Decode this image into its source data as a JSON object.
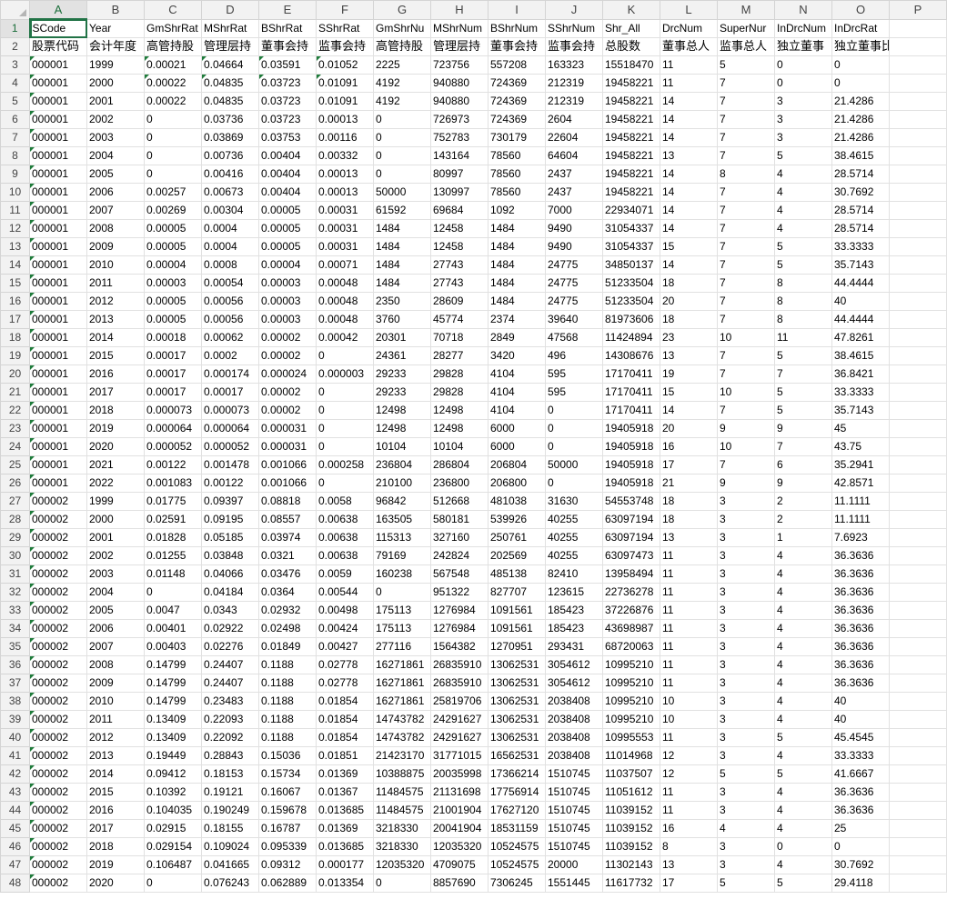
{
  "columns": [
    "A",
    "B",
    "C",
    "D",
    "E",
    "F",
    "G",
    "H",
    "I",
    "J",
    "K",
    "L",
    "M",
    "N",
    "O",
    "P"
  ],
  "selected_column": "A",
  "selected_row": 1,
  "rows": [
    [
      "SCode",
      "Year",
      "GmShrRat",
      "MShrRat",
      "BShrRat",
      "SShrRat",
      "GmShrNu",
      "MShrNum",
      "BShrNum",
      "SShrNum",
      "Shr_All",
      "DrcNum",
      "SuperNur",
      "InDrcNum",
      "InDrcRat",
      ""
    ],
    [
      "股票代码",
      "会计年度",
      "高管持股",
      "管理层持",
      "董事会持",
      "监事会持",
      "高管持股",
      "管理层持",
      "董事会持",
      "监事会持",
      "总股数",
      "董事总人",
      "监事总人",
      "独立董事",
      "独立董事比例（%）",
      ""
    ],
    [
      "000001",
      "1999",
      "0.00021",
      "0.04664",
      "0.03591",
      "0.01052",
      "2225",
      "723756",
      "557208",
      "163323",
      "15518470",
      "11",
      "5",
      "0",
      "0",
      ""
    ],
    [
      "000001",
      "2000",
      "0.00022",
      "0.04835",
      "0.03723",
      "0.01091",
      "4192",
      "940880",
      "724369",
      "212319",
      "19458221",
      "11",
      "7",
      "0",
      "0",
      ""
    ],
    [
      "000001",
      "2001",
      "0.00022",
      "0.04835",
      "0.03723",
      "0.01091",
      "4192",
      "940880",
      "724369",
      "212319",
      "19458221",
      "14",
      "7",
      "3",
      "21.4286",
      ""
    ],
    [
      "000001",
      "2002",
      "0",
      "0.03736",
      "0.03723",
      "0.00013",
      "0",
      "726973",
      "724369",
      "2604",
      "19458221",
      "14",
      "7",
      "3",
      "21.4286",
      ""
    ],
    [
      "000001",
      "2003",
      "0",
      "0.03869",
      "0.03753",
      "0.00116",
      "0",
      "752783",
      "730179",
      "22604",
      "19458221",
      "14",
      "7",
      "3",
      "21.4286",
      ""
    ],
    [
      "000001",
      "2004",
      "0",
      "0.00736",
      "0.00404",
      "0.00332",
      "0",
      "143164",
      "78560",
      "64604",
      "19458221",
      "13",
      "7",
      "5",
      "38.4615",
      ""
    ],
    [
      "000001",
      "2005",
      "0",
      "0.00416",
      "0.00404",
      "0.00013",
      "0",
      "80997",
      "78560",
      "2437",
      "19458221",
      "14",
      "8",
      "4",
      "28.5714",
      ""
    ],
    [
      "000001",
      "2006",
      "0.00257",
      "0.00673",
      "0.00404",
      "0.00013",
      "50000",
      "130997",
      "78560",
      "2437",
      "19458221",
      "14",
      "7",
      "4",
      "30.7692",
      ""
    ],
    [
      "000001",
      "2007",
      "0.00269",
      "0.00304",
      "0.00005",
      "0.00031",
      "61592",
      "69684",
      "1092",
      "7000",
      "22934071",
      "14",
      "7",
      "4",
      "28.5714",
      ""
    ],
    [
      "000001",
      "2008",
      "0.00005",
      "0.0004",
      "0.00005",
      "0.00031",
      "1484",
      "12458",
      "1484",
      "9490",
      "31054337",
      "14",
      "7",
      "4",
      "28.5714",
      ""
    ],
    [
      "000001",
      "2009",
      "0.00005",
      "0.0004",
      "0.00005",
      "0.00031",
      "1484",
      "12458",
      "1484",
      "9490",
      "31054337",
      "15",
      "7",
      "5",
      "33.3333",
      ""
    ],
    [
      "000001",
      "2010",
      "0.00004",
      "0.0008",
      "0.00004",
      "0.00071",
      "1484",
      "27743",
      "1484",
      "24775",
      "34850137",
      "14",
      "7",
      "5",
      "35.7143",
      ""
    ],
    [
      "000001",
      "2011",
      "0.00003",
      "0.00054",
      "0.00003",
      "0.00048",
      "1484",
      "27743",
      "1484",
      "24775",
      "51233504",
      "18",
      "7",
      "8",
      "44.4444",
      ""
    ],
    [
      "000001",
      "2012",
      "0.00005",
      "0.00056",
      "0.00003",
      "0.00048",
      "2350",
      "28609",
      "1484",
      "24775",
      "51233504",
      "20",
      "7",
      "8",
      "40",
      ""
    ],
    [
      "000001",
      "2013",
      "0.00005",
      "0.00056",
      "0.00003",
      "0.00048",
      "3760",
      "45774",
      "2374",
      "39640",
      "81973606",
      "18",
      "7",
      "8",
      "44.4444",
      ""
    ],
    [
      "000001",
      "2014",
      "0.00018",
      "0.00062",
      "0.00002",
      "0.00042",
      "20301",
      "70718",
      "2849",
      "47568",
      "11424894",
      "23",
      "10",
      "11",
      "47.8261",
      ""
    ],
    [
      "000001",
      "2015",
      "0.00017",
      "0.0002",
      "0.00002",
      "0",
      "24361",
      "28277",
      "3420",
      "496",
      "14308676",
      "13",
      "7",
      "5",
      "38.4615",
      ""
    ],
    [
      "000001",
      "2016",
      "0.00017",
      "0.000174",
      "0.000024",
      "0.000003",
      "29233",
      "29828",
      "4104",
      "595",
      "17170411",
      "19",
      "7",
      "7",
      "36.8421",
      ""
    ],
    [
      "000001",
      "2017",
      "0.00017",
      "0.00017",
      "0.00002",
      "0",
      "29233",
      "29828",
      "4104",
      "595",
      "17170411",
      "15",
      "10",
      "5",
      "33.3333",
      ""
    ],
    [
      "000001",
      "2018",
      "0.000073",
      "0.000073",
      "0.00002",
      "0",
      "12498",
      "12498",
      "4104",
      "0",
      "17170411",
      "14",
      "7",
      "5",
      "35.7143",
      ""
    ],
    [
      "000001",
      "2019",
      "0.000064",
      "0.000064",
      "0.000031",
      "0",
      "12498",
      "12498",
      "6000",
      "0",
      "19405918",
      "20",
      "9",
      "9",
      "45",
      ""
    ],
    [
      "000001",
      "2020",
      "0.000052",
      "0.000052",
      "0.000031",
      "0",
      "10104",
      "10104",
      "6000",
      "0",
      "19405918",
      "16",
      "10",
      "7",
      "43.75",
      ""
    ],
    [
      "000001",
      "2021",
      "0.00122",
      "0.001478",
      "0.001066",
      "0.000258",
      "236804",
      "286804",
      "206804",
      "50000",
      "19405918",
      "17",
      "7",
      "6",
      "35.2941",
      ""
    ],
    [
      "000001",
      "2022",
      "0.001083",
      "0.00122",
      "0.001066",
      "0",
      "210100",
      "236800",
      "206800",
      "0",
      "19405918",
      "21",
      "9",
      "9",
      "42.8571",
      ""
    ],
    [
      "000002",
      "1999",
      "0.01775",
      "0.09397",
      "0.08818",
      "0.0058",
      "96842",
      "512668",
      "481038",
      "31630",
      "54553748",
      "18",
      "3",
      "2",
      "11.1111",
      ""
    ],
    [
      "000002",
      "2000",
      "0.02591",
      "0.09195",
      "0.08557",
      "0.00638",
      "163505",
      "580181",
      "539926",
      "40255",
      "63097194",
      "18",
      "3",
      "2",
      "11.1111",
      ""
    ],
    [
      "000002",
      "2001",
      "0.01828",
      "0.05185",
      "0.03974",
      "0.00638",
      "115313",
      "327160",
      "250761",
      "40255",
      "63097194",
      "13",
      "3",
      "1",
      "7.6923",
      ""
    ],
    [
      "000002",
      "2002",
      "0.01255",
      "0.03848",
      "0.0321",
      "0.00638",
      "79169",
      "242824",
      "202569",
      "40255",
      "63097473",
      "11",
      "3",
      "4",
      "36.3636",
      ""
    ],
    [
      "000002",
      "2003",
      "0.01148",
      "0.04066",
      "0.03476",
      "0.0059",
      "160238",
      "567548",
      "485138",
      "82410",
      "13958494",
      "11",
      "3",
      "4",
      "36.3636",
      ""
    ],
    [
      "000002",
      "2004",
      "0",
      "0.04184",
      "0.0364",
      "0.00544",
      "0",
      "951322",
      "827707",
      "123615",
      "22736278",
      "11",
      "3",
      "4",
      "36.3636",
      ""
    ],
    [
      "000002",
      "2005",
      "0.0047",
      "0.0343",
      "0.02932",
      "0.00498",
      "175113",
      "1276984",
      "1091561",
      "185423",
      "37226876",
      "11",
      "3",
      "4",
      "36.3636",
      ""
    ],
    [
      "000002",
      "2006",
      "0.00401",
      "0.02922",
      "0.02498",
      "0.00424",
      "175113",
      "1276984",
      "1091561",
      "185423",
      "43698987",
      "11",
      "3",
      "4",
      "36.3636",
      ""
    ],
    [
      "000002",
      "2007",
      "0.00403",
      "0.02276",
      "0.01849",
      "0.00427",
      "277116",
      "1564382",
      "1270951",
      "293431",
      "68720063",
      "11",
      "3",
      "4",
      "36.3636",
      ""
    ],
    [
      "000002",
      "2008",
      "0.14799",
      "0.24407",
      "0.1188",
      "0.02778",
      "16271861",
      "26835910",
      "13062531",
      "3054612",
      "10995210",
      "11",
      "3",
      "4",
      "36.3636",
      ""
    ],
    [
      "000002",
      "2009",
      "0.14799",
      "0.24407",
      "0.1188",
      "0.02778",
      "16271861",
      "26835910",
      "13062531",
      "3054612",
      "10995210",
      "11",
      "3",
      "4",
      "36.3636",
      ""
    ],
    [
      "000002",
      "2010",
      "0.14799",
      "0.23483",
      "0.1188",
      "0.01854",
      "16271861",
      "25819706",
      "13062531",
      "2038408",
      "10995210",
      "10",
      "3",
      "4",
      "40",
      ""
    ],
    [
      "000002",
      "2011",
      "0.13409",
      "0.22093",
      "0.1188",
      "0.01854",
      "14743782",
      "24291627",
      "13062531",
      "2038408",
      "10995210",
      "10",
      "3",
      "4",
      "40",
      ""
    ],
    [
      "000002",
      "2012",
      "0.13409",
      "0.22092",
      "0.1188",
      "0.01854",
      "14743782",
      "24291627",
      "13062531",
      "2038408",
      "10995553",
      "11",
      "3",
      "5",
      "45.4545",
      ""
    ],
    [
      "000002",
      "2013",
      "0.19449",
      "0.28843",
      "0.15036",
      "0.01851",
      "21423170",
      "31771015",
      "16562531",
      "2038408",
      "11014968",
      "12",
      "3",
      "4",
      "33.3333",
      ""
    ],
    [
      "000002",
      "2014",
      "0.09412",
      "0.18153",
      "0.15734",
      "0.01369",
      "10388875",
      "20035998",
      "17366214",
      "1510745",
      "11037507",
      "12",
      "5",
      "5",
      "41.6667",
      ""
    ],
    [
      "000002",
      "2015",
      "0.10392",
      "0.19121",
      "0.16067",
      "0.01367",
      "11484575",
      "21131698",
      "17756914",
      "1510745",
      "11051612",
      "11",
      "3",
      "4",
      "36.3636",
      ""
    ],
    [
      "000002",
      "2016",
      "0.104035",
      "0.190249",
      "0.159678",
      "0.013685",
      "11484575",
      "21001904",
      "17627120",
      "1510745",
      "11039152",
      "11",
      "3",
      "4",
      "36.3636",
      ""
    ],
    [
      "000002",
      "2017",
      "0.02915",
      "0.18155",
      "0.16787",
      "0.01369",
      "3218330",
      "20041904",
      "18531159",
      "1510745",
      "11039152",
      "16",
      "4",
      "4",
      "25",
      ""
    ],
    [
      "000002",
      "2018",
      "0.029154",
      "0.109024",
      "0.095339",
      "0.013685",
      "3218330",
      "12035320",
      "10524575",
      "1510745",
      "11039152",
      "8",
      "3",
      "0",
      "0",
      ""
    ],
    [
      "000002",
      "2019",
      "0.106487",
      "0.041665",
      "0.09312",
      "0.000177",
      "12035320",
      "4709075",
      "10524575",
      "20000",
      "11302143",
      "13",
      "3",
      "4",
      "30.7692",
      ""
    ],
    [
      "000002",
      "2020",
      "0",
      "0.076243",
      "0.062889",
      "0.013354",
      "0",
      "8857690",
      "7306245",
      "1551445",
      "11617732",
      "17",
      "5",
      "5",
      "29.4118",
      ""
    ]
  ]
}
